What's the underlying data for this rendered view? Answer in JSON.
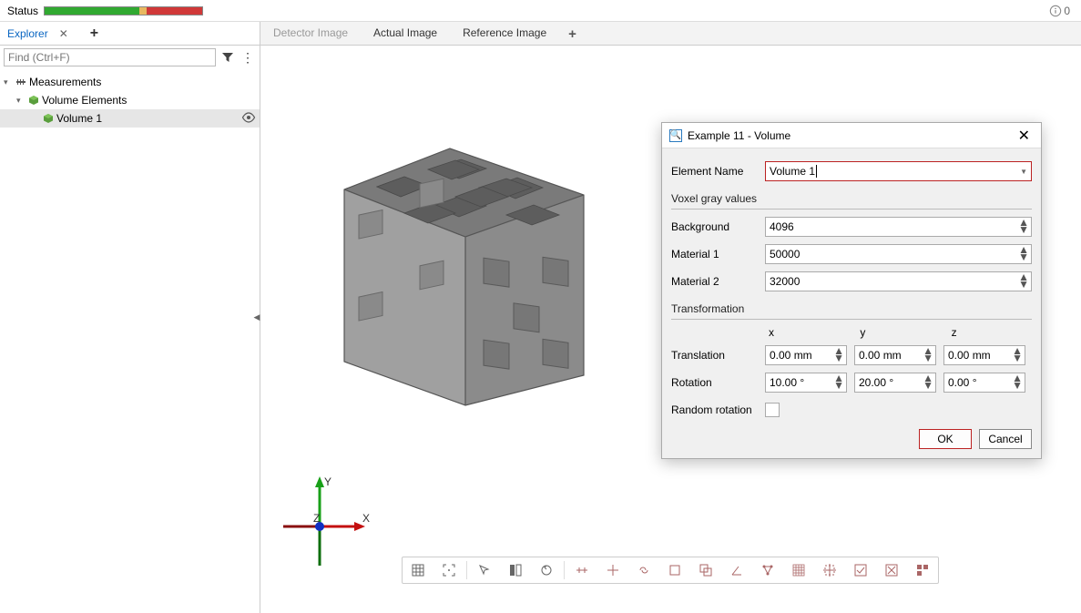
{
  "status": {
    "label": "Status",
    "info_count": "0"
  },
  "explorer": {
    "tab": "Explorer",
    "find_placeholder": "Find (Ctrl+F)",
    "tree": {
      "root": "Measurements",
      "group": "Volume Elements",
      "item": "Volume 1"
    }
  },
  "view_tabs": {
    "t1": "Detector Image",
    "t2": "Actual Image",
    "t3": "Reference Image"
  },
  "axes": {
    "x": "X",
    "y": "Y",
    "z": "Z"
  },
  "dialog": {
    "title": "Example 11 - Volume",
    "element_name_label": "Element Name",
    "element_name_value": "Volume 1",
    "section_voxel": "Voxel gray values",
    "background_label": "Background",
    "background_value": "4096",
    "material1_label": "Material 1",
    "material1_value": "50000",
    "material2_label": "Material 2",
    "material2_value": "32000",
    "section_transform": "Transformation",
    "col_x": "x",
    "col_y": "y",
    "col_z": "z",
    "translation_label": "Translation",
    "tx": "0.00 mm",
    "ty": "0.00 mm",
    "tz": "0.00 mm",
    "rotation_label": "Rotation",
    "rx": "10.00 °",
    "ry": "20.00 °",
    "rz": "0.00 °",
    "random_rotation_label": "Random rotation",
    "ok": "OK",
    "cancel": "Cancel"
  }
}
